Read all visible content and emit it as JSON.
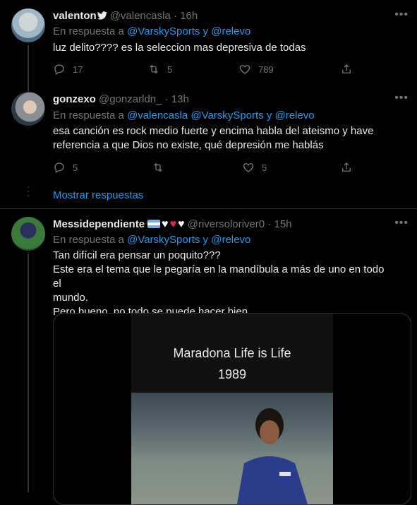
{
  "tweets": [
    {
      "name": "valenton",
      "handle": "@valencasla",
      "time": "· 16h",
      "reply_prefix": "En respuesta a",
      "mentions": "@VarskySports y @relevo",
      "text": "luz delito???? es la seleccion mas depresiva de todas",
      "replies": "17",
      "retweets": "5",
      "likes": "789"
    },
    {
      "name": "gonzexo",
      "handle": "@gonzarldn_",
      "time": "· 13h",
      "reply_prefix": "En respuesta a",
      "mentions": "@valencasla @VarskySports y @relevo",
      "text_lines": [
        "esa canción es rock medio fuerte y encima habla del ateismo y have",
        "referencia a que Dios no existe, qué depresión me hablás"
      ],
      "replies": "5",
      "retweets": "",
      "likes": "5"
    },
    {
      "name": "Messidependiente",
      "handle": "@riversoloriver0",
      "time": "· 15h",
      "reply_prefix": "En respuesta a",
      "mentions": "@VarskySports y @relevo",
      "text_lines": [
        "Tan difícil era pensar un poquito???",
        "Este era el tema que le pegaría en la mandíbula a más de uno en todo el",
        "mundo.",
        "Pero bueno, no todo se puede hacer bien."
      ],
      "video_title_line1": "Maradona Life is Life",
      "video_title_line2": "1989"
    }
  ],
  "show_replies": "Mostrar respuestas",
  "more_icon": "•••",
  "colors": {
    "link": "#1d9bf0",
    "muted": "#71767b",
    "background": "#000000"
  }
}
